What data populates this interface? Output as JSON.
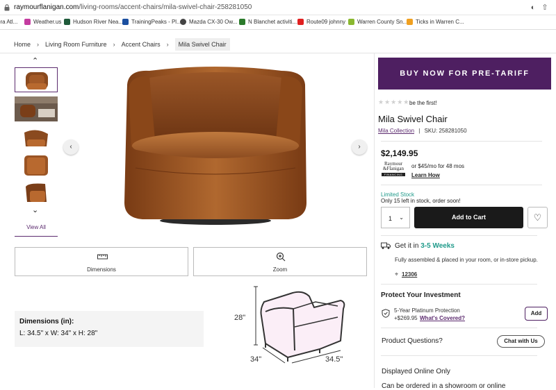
{
  "browser": {
    "url_domain": "raymourflanigan.com",
    "url_path": "/living-rooms/accent-chairs/mila-swivel-chair-258281050"
  },
  "bookmarks": [
    {
      "label": "ora Atl...",
      "color": "#3a3a8c"
    },
    {
      "label": "Weather.us",
      "color": "#c43ca0"
    },
    {
      "label": "Hudson River Nea...",
      "color": "#1f5a3a"
    },
    {
      "label": "TrainingPeaks - Pl...",
      "color": "#1b4fa0"
    },
    {
      "label": "Mazda CX-30 Ow...",
      "color": "#444444"
    },
    {
      "label": "N Blanchet activiti...",
      "color": "#2b7a2b"
    },
    {
      "label": "Route09 johnny",
      "color": "#e02020"
    },
    {
      "label": "Warren County Sn...",
      "color": "#8ab830"
    },
    {
      "label": "Ticks in Warren C...",
      "color": "#f0a020"
    }
  ],
  "breadcrumbs": [
    "Home",
    "Living Room Furniture",
    "Accent Chairs",
    "Mila Swivel Chair"
  ],
  "gallery": {
    "view_all": "View All",
    "dimensions_label": "Dimensions",
    "zoom_label": "Zoom"
  },
  "dimensions": {
    "title": "Dimensions (in):",
    "value": "L: 34.5\" x W: 34\" x H: 28\"",
    "height_label": "28\"",
    "width_label": "34\"",
    "depth_label": "34.5\""
  },
  "promo": {
    "banner": "BUY NOW FOR PRE-TARIFF PRICING"
  },
  "product": {
    "stars": "★★★★★",
    "rating_text": "be the first!",
    "name": "Mila Swivel Chair",
    "collection": "Mila Collection",
    "sku": "SKU: 258281050",
    "price": "$2,149.95",
    "financing_logo_top": "Raymour",
    "financing_logo_bottom": "&Flanigan",
    "financing_logo_tag": "FINANCING",
    "monthly": "or $45/mo for 48 mos",
    "learn_how": "Learn How",
    "stock_status": "Limited Stock",
    "stock_detail": "Only 15 left in stock, order soon!",
    "qty": "1",
    "add_to_cart": "Add to Cart"
  },
  "delivery": {
    "get_it_prefix": "Get it in ",
    "weeks": "3-5 Weeks",
    "assembled": "Fully assembled & placed in your room, or in-store pickup.",
    "zip": "12306"
  },
  "protection": {
    "title": "Protect Your Investment",
    "plan": "5-Year Platinum Protection",
    "plan_price": "+$269.95",
    "whats_covered": "What's Covered?",
    "add": "Add"
  },
  "questions": {
    "label": "Product Questions?",
    "chat": "Chat with Us"
  },
  "availability": {
    "displayed": "Displayed Online Only",
    "order_note": "Can be ordered in a showroom or online"
  },
  "colors": {
    "brand_purple": "#4e1f61",
    "teal": "#1f9a8a",
    "leather": "#8a4a1f"
  }
}
